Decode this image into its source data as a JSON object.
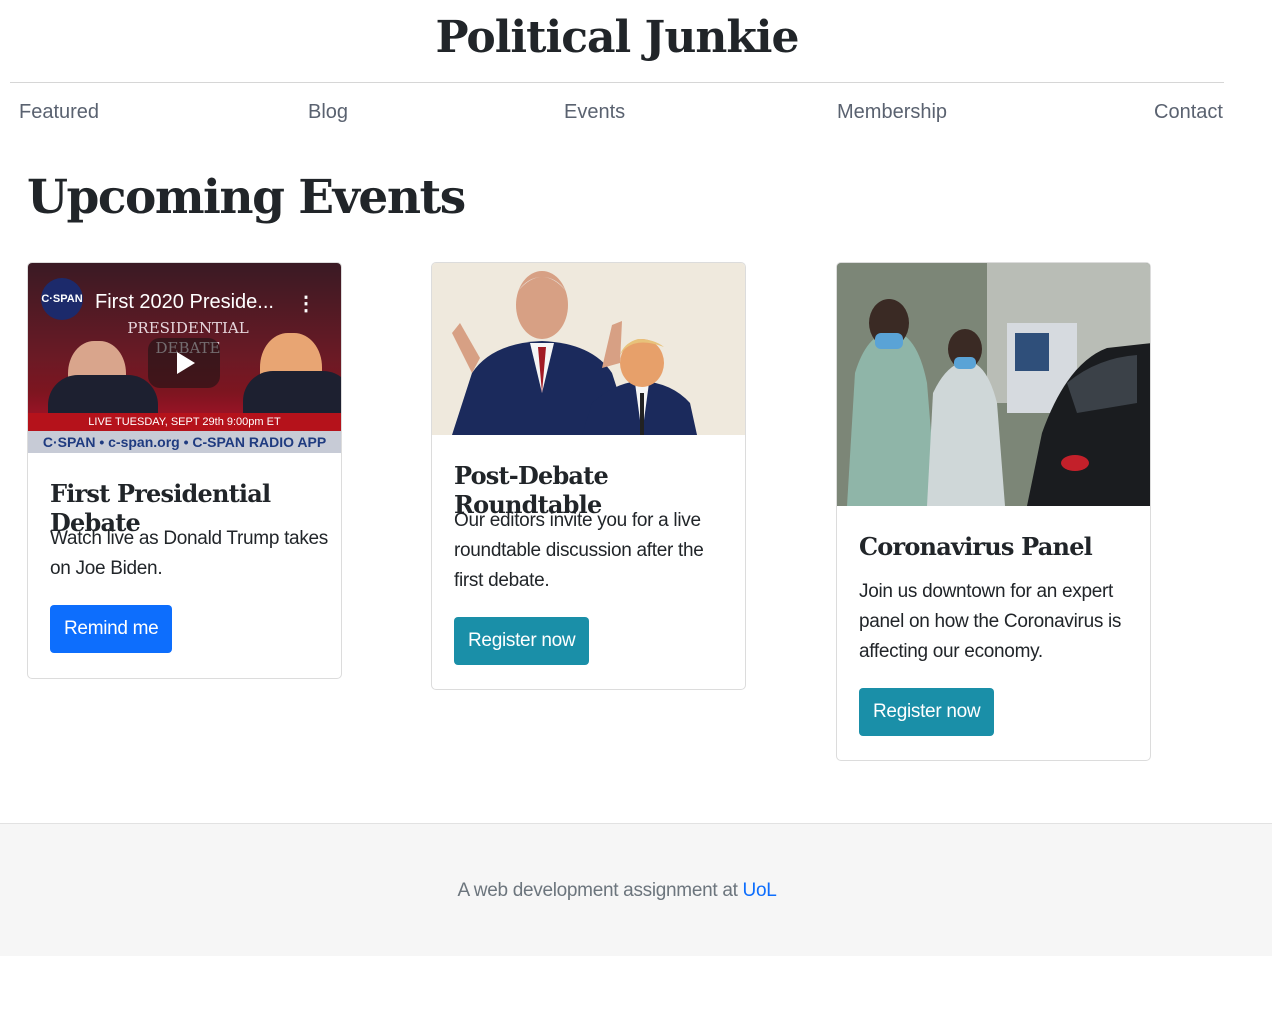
{
  "header": {
    "title": "Political Junkie"
  },
  "nav": {
    "items": [
      {
        "label": "Featured"
      },
      {
        "label": "Blog"
      },
      {
        "label": "Events"
      },
      {
        "label": "Membership"
      },
      {
        "label": "Contact"
      }
    ]
  },
  "main": {
    "heading": "Upcoming Events",
    "cards": [
      {
        "title": "First Presidential Debate",
        "text": "Watch live as Donald Trump takes on Joe Biden.",
        "button": "Remind me",
        "video": {
          "channel_logo": "C·SPAN",
          "title": "First 2020 Preside...",
          "overlay_line1": "PRESIDENTIAL",
          "overlay_line2": "DEBATE",
          "banner": "LIVE TUESDAY, SEPT 29th 9:00pm ET",
          "footer_strip": "C·SPAN  •  c-span.org  •  C-SPAN RADIO APP"
        }
      },
      {
        "title": "Post-Debate Roundtable",
        "text": "Our editors invite you for a live roundtable discussion after the first debate.",
        "button": "Register now"
      },
      {
        "title": "Coronavirus Panel",
        "text": "Join us downtown for an expert panel on how the Coronavirus is affecting our economy.",
        "button": "Register now"
      }
    ]
  },
  "footer": {
    "text": "A web development assignment at ",
    "link": "UoL"
  },
  "colors": {
    "primary": "#0d6efd",
    "info": "#1a8fa8",
    "footer_bg": "#f6f6f6"
  }
}
